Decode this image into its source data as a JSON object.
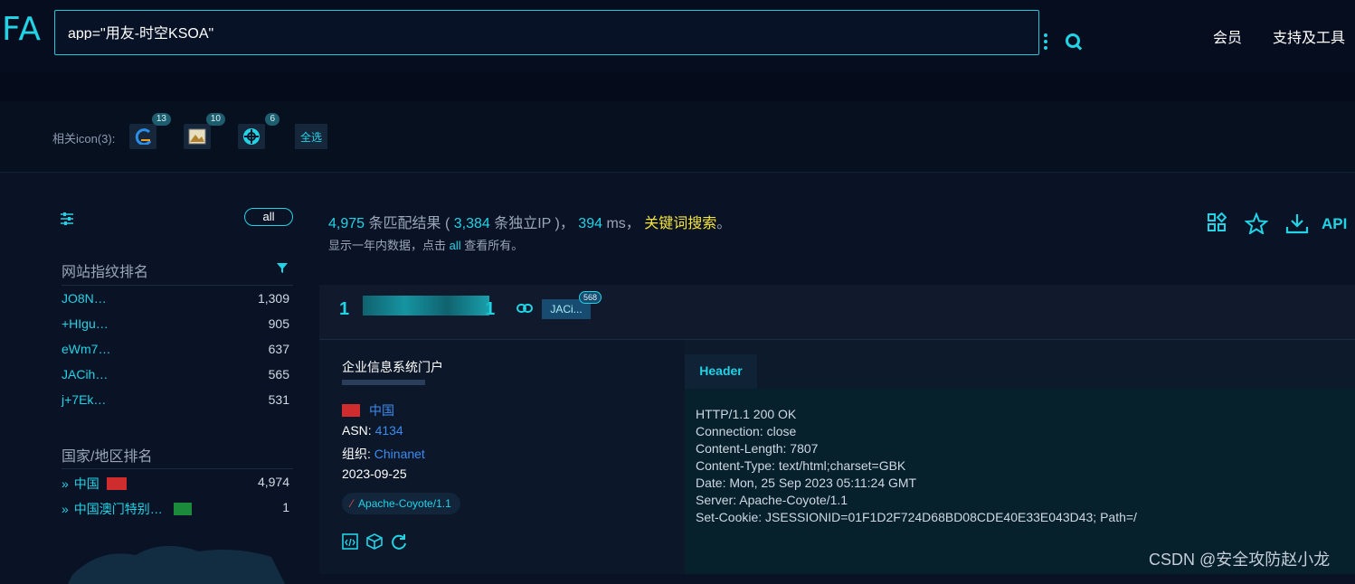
{
  "brand": {
    "logo": "FA",
    "accent": "#22d3e6"
  },
  "search": {
    "query": "app=\"用友-时空KSOA\""
  },
  "nav": {
    "member": "会员",
    "tools": "支持及工具"
  },
  "related_icons": {
    "label": "相关icon(3):",
    "items": [
      {
        "count": "13",
        "icon": "swirl-logo-icon"
      },
      {
        "count": "10",
        "icon": "landscape-image-icon"
      },
      {
        "count": "6",
        "icon": "globe-logo-icon"
      }
    ],
    "select_all": "全选"
  },
  "sidebar": {
    "all_label": "all",
    "fingerprint_title": "网站指纹排名",
    "fingerprints": [
      {
        "name": "JO8N…",
        "count": "1,309"
      },
      {
        "name": "+HIgu…",
        "count": "905"
      },
      {
        "name": "eWm7…",
        "count": "637"
      },
      {
        "name": "JACih…",
        "count": "565"
      },
      {
        "name": "j+7Ek…",
        "count": "531"
      }
    ],
    "country_title": "国家/地区排名",
    "countries": [
      {
        "name": "中国",
        "count": "4,974",
        "flag_color": "#cf2d2d"
      },
      {
        "name": "中国澳门特别…",
        "count": "1",
        "flag_color": "#1b8a3a"
      }
    ]
  },
  "results": {
    "count": "4,975",
    "text1": "条匹配结果 (",
    "ip_count": "3,384",
    "text2": "条独立IP )，",
    "ms": "394",
    "text3": "ms，",
    "keyword_search": "关键词搜索",
    "text4": "。",
    "sub_text1": "显示一年内数据，点击",
    "sub_all": "all",
    "sub_text2": "查看所有。",
    "api_label": "API"
  },
  "card": {
    "ip_start": "1",
    "ip_end": "1",
    "tag": "JACi...",
    "tag_count": "568",
    "title": "企业信息系统门户",
    "country": "中国",
    "asn_label": "ASN:",
    "asn": "4134",
    "org_label": "组织:",
    "org": "Chinanet",
    "date": "2023-09-25",
    "server": "Apache-Coyote/1.1",
    "tab": "Header",
    "header_lines": [
      "HTTP/1.1 200 OK",
      "Connection: close",
      "Content-Length: 7807",
      "Content-Type: text/html;charset=GBK",
      "Date: Mon, 25 Sep 2023 05:11:24 GMT",
      "Server: Apache-Coyote/1.1",
      "Set-Cookie: JSESSIONID=01F1D2F724D68BD08CDE40E33E043D43; Path=/"
    ]
  },
  "watermark": "CSDN @安全攻防赵小龙"
}
